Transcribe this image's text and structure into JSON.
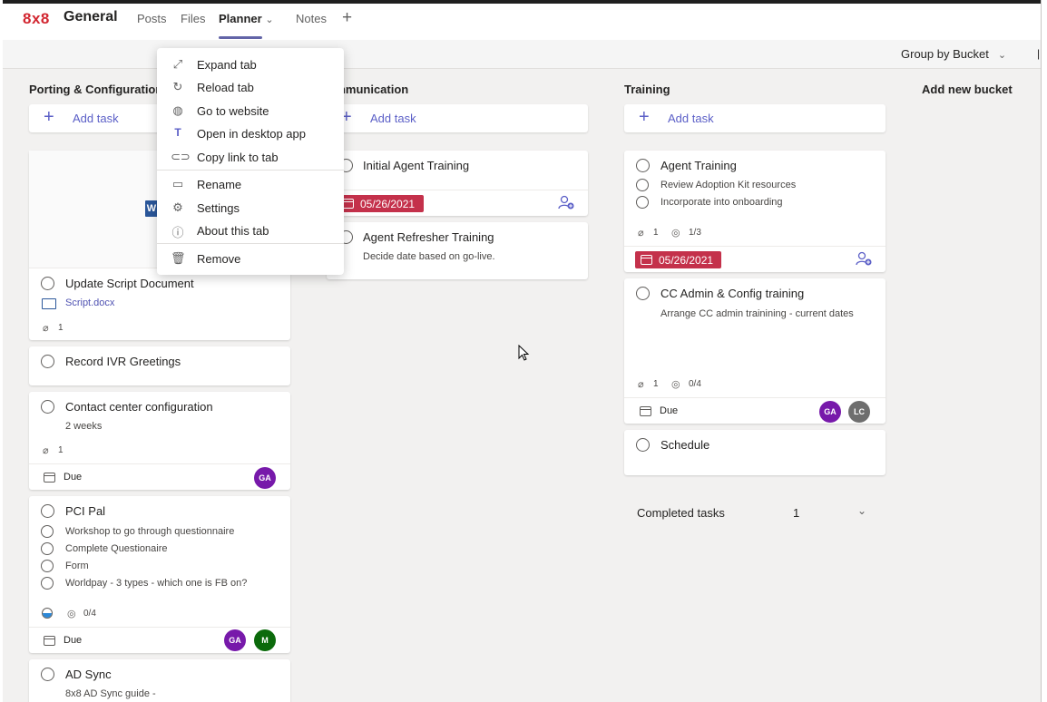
{
  "header": {
    "logo": "8x8",
    "channel": "General",
    "tabs": [
      "Posts",
      "Files",
      "Planner",
      "Notes"
    ],
    "active_tab_suffix": "⌄"
  },
  "toolbar": {
    "group_by": "Group by Bucket"
  },
  "context_menu": {
    "items": [
      "Expand tab",
      "Reload tab",
      "Go to website",
      "Open in desktop app",
      "Copy link to tab",
      "Rename",
      "Settings",
      "About this tab",
      "Remove"
    ]
  },
  "buckets": {
    "b1": {
      "title": "Porting & Configuration",
      "add": "Add task"
    },
    "b2": {
      "title": "Communication",
      "add": "Add task"
    },
    "b3": {
      "title": "Training",
      "add": "Add task"
    },
    "new": "Add new bucket"
  },
  "cards": {
    "update_script": {
      "title": "Update Script Document",
      "file": "Script.docx",
      "attach": "1"
    },
    "record_ivr": {
      "title": "Record IVR Greetings"
    },
    "contact_center": {
      "title": "Contact center configuration",
      "desc": "2 weeks",
      "attach": "1",
      "due": "Due",
      "av": "GA"
    },
    "pci": {
      "title": "PCI Pal",
      "items": [
        "Workshop to go through questionnaire",
        "Complete Questionaire",
        "Form",
        "Worldpay - 3 types - which one is FB on?"
      ],
      "progress": "0/4",
      "due": "Due",
      "av1": "GA",
      "av2": "M"
    },
    "adsync": {
      "title": "AD Sync",
      "desc": "8x8 AD Sync guide -"
    },
    "initial_agent": {
      "title": "Initial Agent Training",
      "date": "05/26/2021"
    },
    "refresher": {
      "title": "Agent Refresher Training",
      "desc": "Decide date based on go-live."
    },
    "agent_training": {
      "title": "Agent Training",
      "items": [
        "Review Adoption Kit resources",
        "Incorporate into onboarding"
      ],
      "attach": "1",
      "progress": "1/3",
      "date": "05/26/2021"
    },
    "cc_admin": {
      "title": "CC Admin & Config training",
      "desc": "Arrange CC admin trainining - current dates",
      "attach": "1",
      "progress": "0/4",
      "due": "Due",
      "av1": "GA",
      "av2": "LC"
    },
    "schedule": {
      "title": "Schedule"
    }
  },
  "completed": {
    "label": "Completed tasks",
    "count": "1"
  },
  "colors": {
    "accent": "#6264a7",
    "overdue": "#c4314b",
    "av_ga": "#7719aa",
    "av_m": "#0b6a0b",
    "av_lc": "#6e6e6e"
  }
}
